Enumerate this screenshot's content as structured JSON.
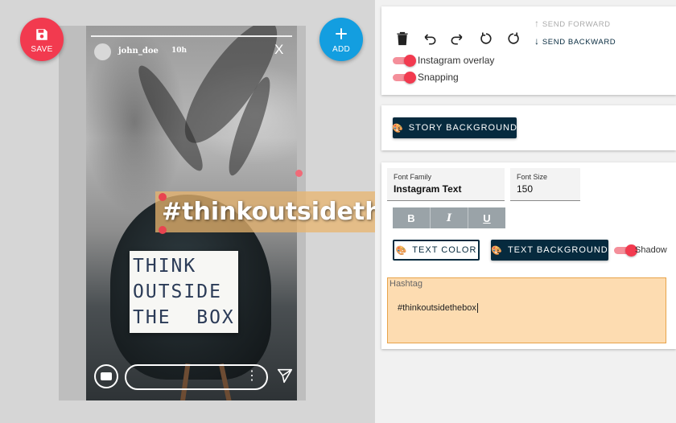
{
  "canvas": {
    "save_label": "SAVE",
    "add_label": "ADD",
    "story": {
      "username": "john_doe",
      "time": "10h",
      "close": "X",
      "lightbox_lines": [
        "THINK",
        "OUTSIDE",
        "THE  BOX"
      ]
    },
    "hashtag_overlay": "#thinkoutsidethebox"
  },
  "toolbar": {
    "delete_icon": "trash-icon",
    "undo_icon": "undo-icon",
    "redo_icon": "redo-icon",
    "rotate_left_icon": "rotate-left-icon",
    "rotate_right_icon": "rotate-right-icon",
    "send_forward": "SEND FORWARD",
    "send_backward": "SEND BACKWARD",
    "toggles": [
      {
        "label": "Instagram overlay",
        "on": true
      },
      {
        "label": "Snapping",
        "on": true
      }
    ]
  },
  "background_card": {
    "story_background": "STORY BACKGROUND"
  },
  "text_card": {
    "font_family_label": "Font Family",
    "font_family_value": "Instagram Text",
    "font_size_label": "Font Size",
    "font_size_value": "150",
    "format_buttons": [
      "B",
      "I",
      "U"
    ],
    "text_color": "TEXT COLOR",
    "text_background": "TEXT BACKGROUND",
    "shadow_label": "Shadow",
    "shadow_on": true,
    "hashtag_label": "Hashtag",
    "hashtag_value": "#thinkoutsidethebox"
  },
  "colors": {
    "save": "#f23a4f",
    "add": "#139ee0",
    "dark_button": "#062a3e",
    "toggle": "#f23a4f",
    "hashtag_field": "#fddcb1"
  }
}
